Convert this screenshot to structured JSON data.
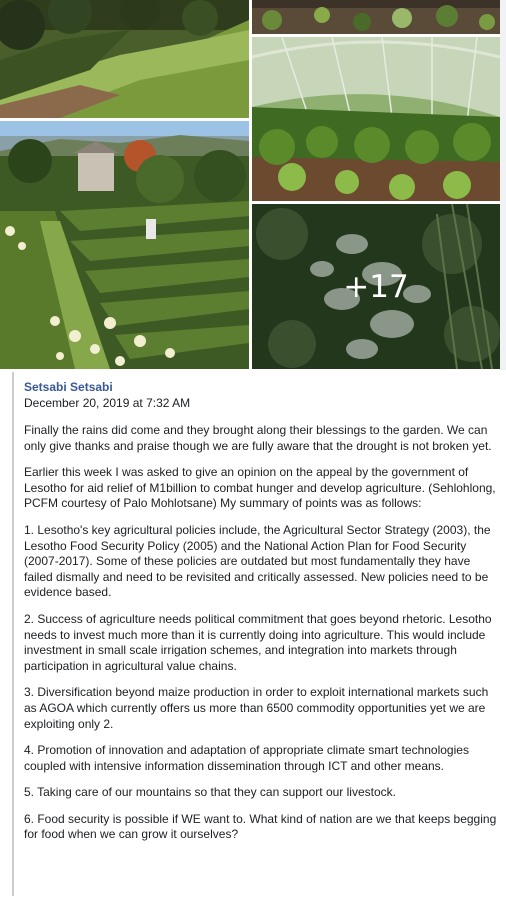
{
  "gallery": {
    "more_count": "+17"
  },
  "post": {
    "author": "Setsabi Setsabi",
    "timestamp": "December 20, 2019 at 7:32 AM",
    "paragraphs": [
      "Finally the rains did come and they brought along their blessings to the garden. We can only give thanks and praise though we are fully aware that the drought is not broken yet.",
      "Earlier this week I was asked to give an opinion on the appeal by the government of Lesotho for aid relief of M1billion to combat hunger and develop agriculture. (Sehlohlong, PCFM courtesy of Palo Mohlotsane) My summary of points was as follows:",
      "1. Lesotho's key agricultural policies include, the Agricultural Sector Strategy (2003), the Lesotho Food Security Policy (2005) and the National Action Plan for Food Security (2007-2017). Some of these policies are outdated but most fundamentally they have failed dismally and need to be revisited and critically assessed. New policies need to be evidence based.",
      "2. Success of agriculture needs political commitment that goes beyond rhetoric. Lesotho needs to invest much more than it is currently doing into agriculture. This would include investment in small scale irrigation schemes, and integration into markets through participation in agricultural value chains.",
      "3. Diversification beyond maize production in order to exploit international markets such as AGOA which currently offers us more than 6500 commodity opportunities yet we are exploiting only 2.",
      "4. Promotion of innovation and adaptation of appropriate climate smart technologies coupled with intensive information dissemination through ICT and other means.",
      "5. Taking care of our mountains so that they can support our livestock.",
      "6. Food security is possible if WE want to. What kind of nation are we that keeps begging for food when we can grow it ourselves?"
    ]
  }
}
